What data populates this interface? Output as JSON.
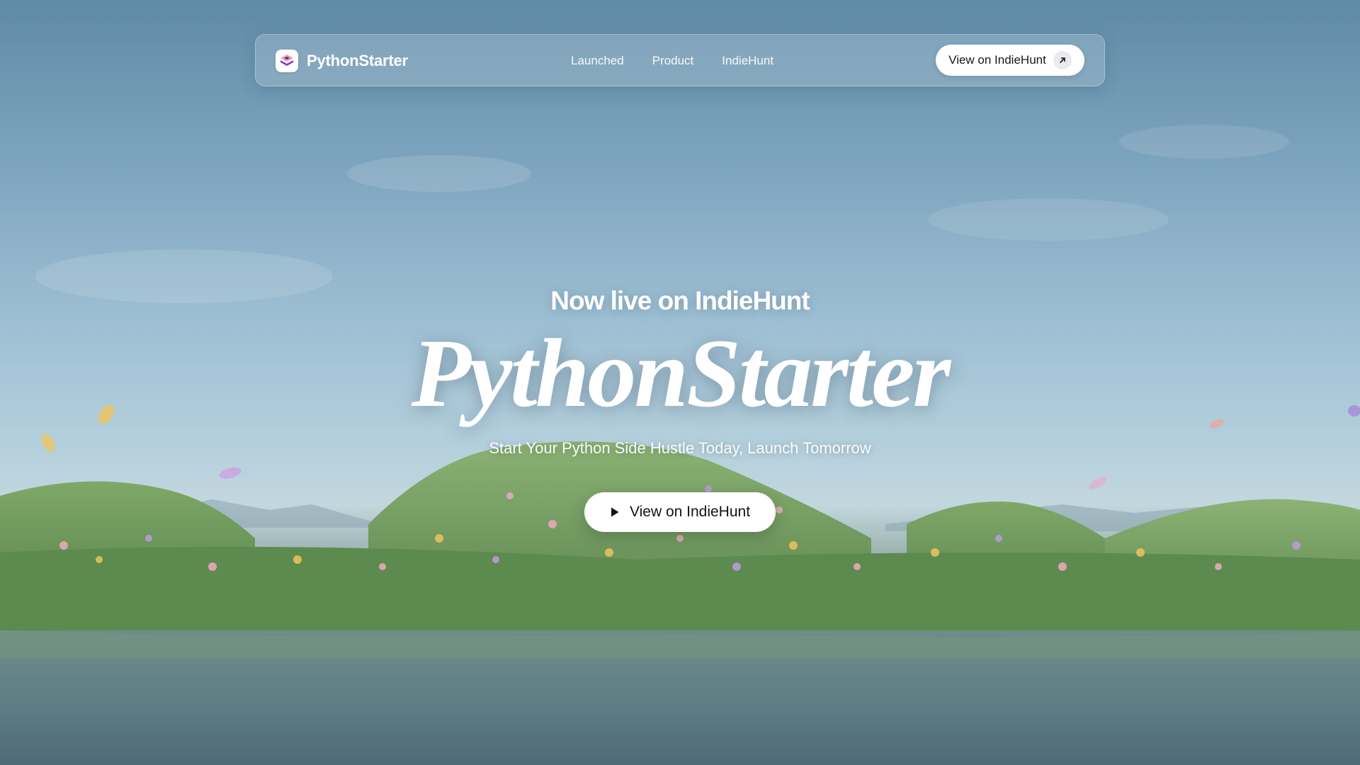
{
  "nav": {
    "brand": "PythonStarter",
    "links": [
      {
        "label": "Launched"
      },
      {
        "label": "Product"
      },
      {
        "label": "IndieHunt"
      }
    ],
    "cta_label": "View on IndieHunt",
    "cta_icon": "arrow-up-right-icon"
  },
  "hero": {
    "eyebrow": "Now live on IndieHunt",
    "title": "PythonStarter",
    "subtitle": "Start Your Python Side Hustle Today, Launch Tomorrow",
    "cta_label": "View on IndieHunt",
    "cta_icon": "play-icon"
  },
  "colors": {
    "sky_top": "#5f8aa6",
    "sky_mid": "#9dbfd3",
    "grass": "#6d9a5a",
    "water": "#5e7c82",
    "button_bg": "#ffffff",
    "button_text": "#111316",
    "logo_accent": "#7b3fc2"
  }
}
